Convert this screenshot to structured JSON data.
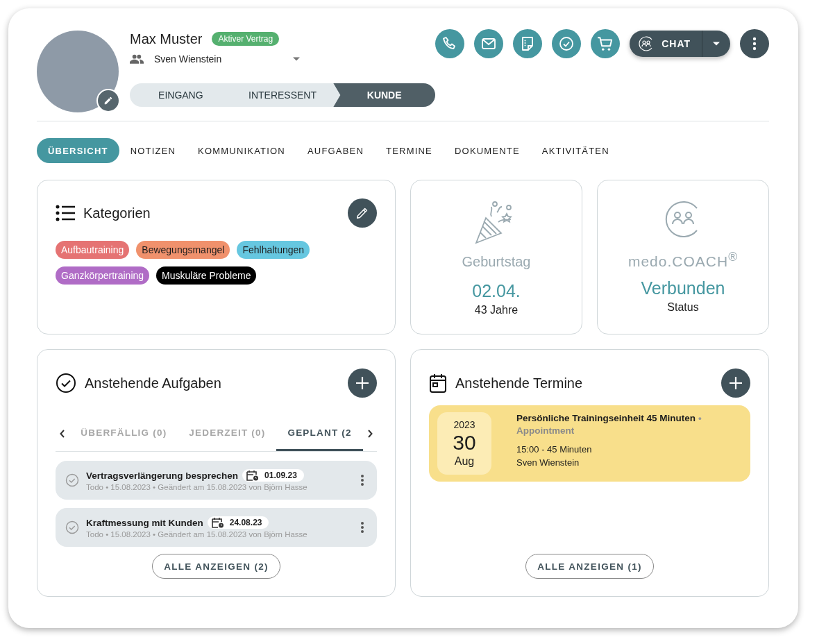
{
  "profile": {
    "name": "Max Muster",
    "contract_badge": "Aktiver Vertrag",
    "assignee": "Sven Wienstein",
    "stages": [
      {
        "label": "EINGANG",
        "selected": false
      },
      {
        "label": "INTERESSENT",
        "selected": false
      },
      {
        "label": "KUNDE",
        "selected": true
      }
    ]
  },
  "chat_button": {
    "label": "CHAT"
  },
  "tabs": [
    {
      "label": "ÜBERSICHT",
      "selected": true
    },
    {
      "label": "NOTIZEN",
      "selected": false
    },
    {
      "label": "KOMMUNIKATION",
      "selected": false
    },
    {
      "label": "AUFGABEN",
      "selected": false
    },
    {
      "label": "TERMINE",
      "selected": false
    },
    {
      "label": "DOKUMENTE",
      "selected": false
    },
    {
      "label": "AKTIVITÄTEN",
      "selected": false
    }
  ],
  "categories": {
    "title": "Kategorien",
    "tags": [
      {
        "label": "Aufbautraining",
        "color": "#e57373"
      },
      {
        "label": "Bewegungsmangel",
        "color": "#f0916c"
      },
      {
        "label": "Fehlhaltungen",
        "color": "#66c7e0"
      },
      {
        "label": "Ganzkörpertraining",
        "color": "#b06cc6"
      },
      {
        "label": "Muskuläre Probleme",
        "color": "#000000"
      }
    ]
  },
  "birthday": {
    "title": "Geburtstag",
    "date": "02.04.",
    "age": "43 Jahre"
  },
  "coach": {
    "brand": "medo.COACH$^{®}$",
    "status": "Verbunden",
    "status_label": "Status"
  },
  "tasks": {
    "title": "Anstehende Aufgaben",
    "tabs": [
      {
        "label": "ÜBERFÄLLIG (0)",
        "selected": false
      },
      {
        "label": "JEDERZEIT (0)",
        "selected": false
      },
      {
        "label": "GEPLANT (2",
        "selected": true
      }
    ],
    "items": [
      {
        "title": "Vertragsverlängerung besprechen",
        "due": "01.09.23",
        "meta": "Todo • 15.08.2023 • Geändert am 15.08.2023 von Björn Hasse"
      },
      {
        "title": "Kraftmessung mit Kunden",
        "due": "24.08.23",
        "meta": "Todo • 15.08.2023 • Geändert am 15.08.2023 von Björn Hasse"
      }
    ],
    "show_all": "ALLE ANZEIGEN (2)"
  },
  "appointments": {
    "title": "Anstehende Termine",
    "items": [
      {
        "year": "2023",
        "day": "30",
        "month": "Aug",
        "title": "Persönliche Trainingseinheit 45 Minuten",
        "separator": "•",
        "type": "Appointment",
        "time": "15:00 - 45 Minuten",
        "person": "Sven Wienstein"
      }
    ],
    "show_all": "ALLE ANZEIGEN (1)"
  }
}
